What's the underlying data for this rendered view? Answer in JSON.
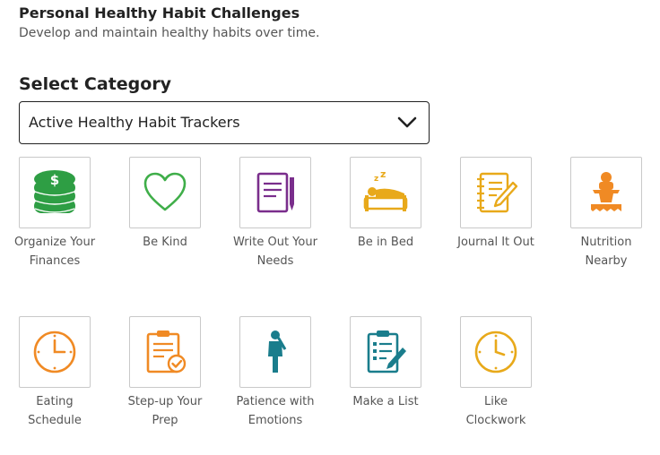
{
  "header": {
    "title": "Personal Healthy Habit Challenges",
    "subtitle": "Develop and maintain healthy habits over time."
  },
  "category": {
    "label": "Select Category",
    "selected": "Active Healthy Habit Trackers"
  },
  "tiles": [
    {
      "label": "Organize Your Finances",
      "icon": "money-stack-icon",
      "color": "#2e9e44"
    },
    {
      "label": "Be Kind",
      "icon": "heart-icon",
      "color": "#3fae49"
    },
    {
      "label": "Write Out Your Needs",
      "icon": "notebook-pen-icon",
      "color": "#7a2e8c"
    },
    {
      "label": "Be in Bed",
      "icon": "sleeping-bed-icon",
      "color": "#e8a91a"
    },
    {
      "label": "Journal It Out",
      "icon": "journal-pencil-icon",
      "color": "#e8a91a"
    },
    {
      "label": "Nutrition Nearby",
      "icon": "mortar-pestle-icon",
      "color": "#f08a24"
    },
    {
      "label": "Eating Schedule",
      "icon": "clock-icon",
      "color": "#f08a24"
    },
    {
      "label": "Step-up Your Prep",
      "icon": "clipboard-check-icon",
      "color": "#f08a24"
    },
    {
      "label": "Patience with Emotions",
      "icon": "thinking-person-icon",
      "color": "#1a7d8c"
    },
    {
      "label": "Make a List",
      "icon": "checklist-pen-icon",
      "color": "#1a7d8c"
    },
    {
      "label": "Like Clockwork",
      "icon": "clock-icon",
      "color": "#e8a91a"
    }
  ]
}
